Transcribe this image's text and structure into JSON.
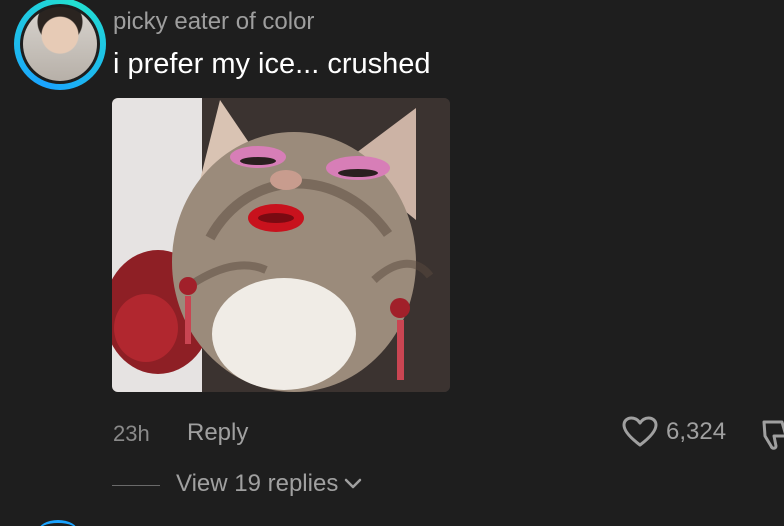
{
  "comment": {
    "username": "picky eater of color",
    "text": "i prefer my ice... crushed",
    "time": "23h",
    "reply_label": "Reply",
    "like_count": "6,324",
    "view_replies_label": "View 19 replies"
  },
  "icons": {
    "like": "heart-outline-icon",
    "dislike": "thumbs-down-icon",
    "expand": "chevron-down-icon"
  },
  "colors": {
    "background": "#1e1e1e",
    "avatar_ring": "#1aa3ff",
    "muted_text": "#a0a0a0"
  }
}
